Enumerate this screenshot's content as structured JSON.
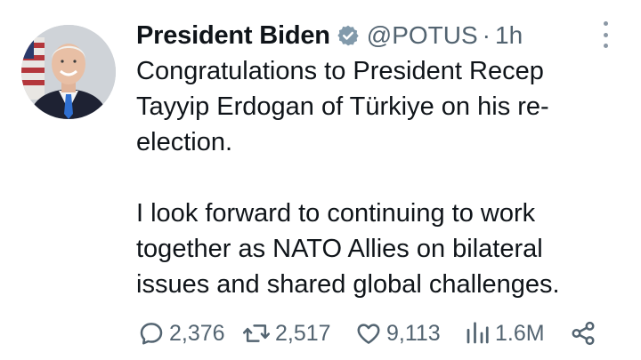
{
  "author": {
    "name": "President Biden",
    "handle": "@POTUS",
    "separator": "·",
    "time": "1h",
    "verified": true,
    "verified_color": "#829aab"
  },
  "tweet": {
    "paragraphs": [
      "Congratulations to President Recep Tayyip Erdogan of Türkiye on his re-election.",
      "I look forward to continuing to work together as NATO Allies on bilateral issues and shared global challenges."
    ]
  },
  "actions": {
    "reply_count": "2,376",
    "retweet_count": "2,517",
    "like_count": "9,113",
    "views_count": "1.6M"
  },
  "icons": {
    "more": "more-vertical-icon",
    "reply": "reply-icon",
    "retweet": "retweet-icon",
    "like": "heart-icon",
    "views": "views-icon",
    "share": "share-icon"
  },
  "colors": {
    "text_primary": "#0f1419",
    "text_secondary": "#536471",
    "icon_gray": "#536471"
  }
}
